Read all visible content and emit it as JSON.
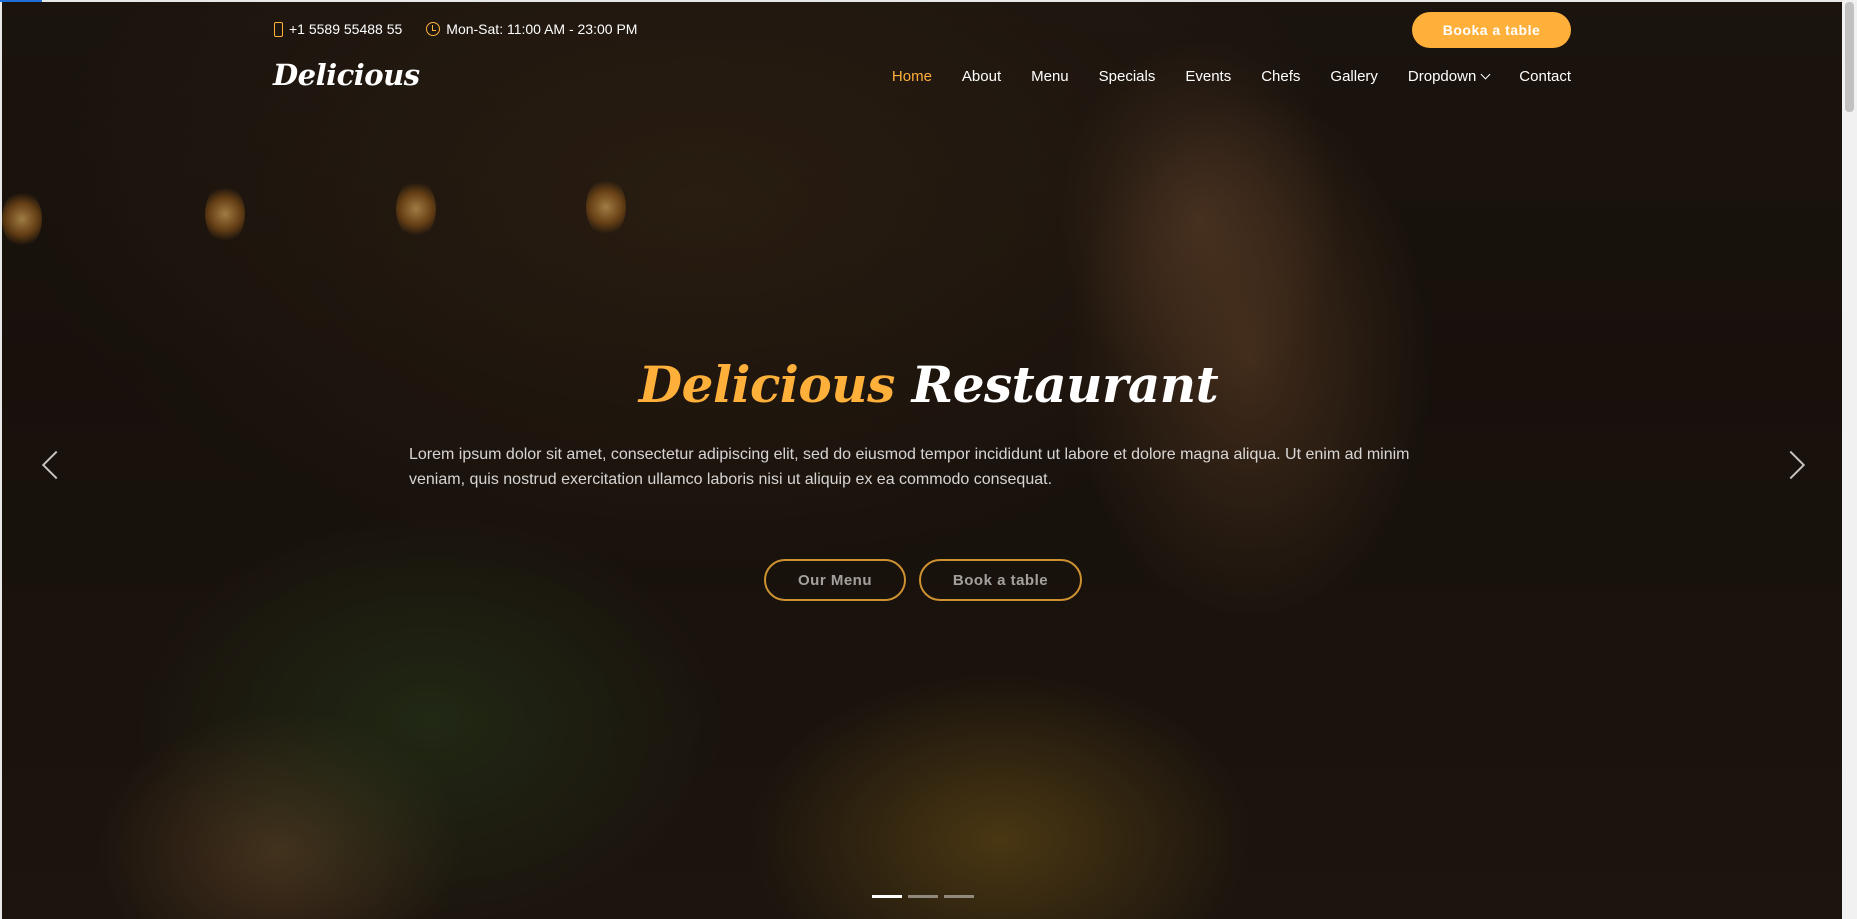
{
  "topbar": {
    "phone": "+1 5589 55488 55",
    "hours": "Mon-Sat: 11:00 AM - 23:00 PM",
    "book_button": "Booka a table"
  },
  "header": {
    "logo": "Delicious",
    "nav": [
      "Home",
      "About",
      "Menu",
      "Specials",
      "Events",
      "Chefs",
      "Gallery",
      "Dropdown",
      "Contact"
    ],
    "active_nav": "Home"
  },
  "hero": {
    "title_accent": "Delicious",
    "title_rest": "Restaurant",
    "text": "Lorem ipsum dolor sit amet, consectetur adipiscing elit, sed do eiusmod tempor incididunt ut labore et dolore magna aliqua. Ut enim ad minim veniam, quis nostrud exercitation ullamco laboris nisi ut aliquip ex ea commodo consequat.",
    "button_menu": "Our Menu",
    "button_book": "Book a table",
    "slides_count": 3,
    "active_slide": 1
  },
  "colors": {
    "accent": "#ffb03b",
    "button_border": "#cd9131"
  },
  "icons": [
    "phone-icon",
    "clock-icon",
    "chevron-down-icon",
    "chevron-left-icon",
    "chevron-right-icon"
  ]
}
